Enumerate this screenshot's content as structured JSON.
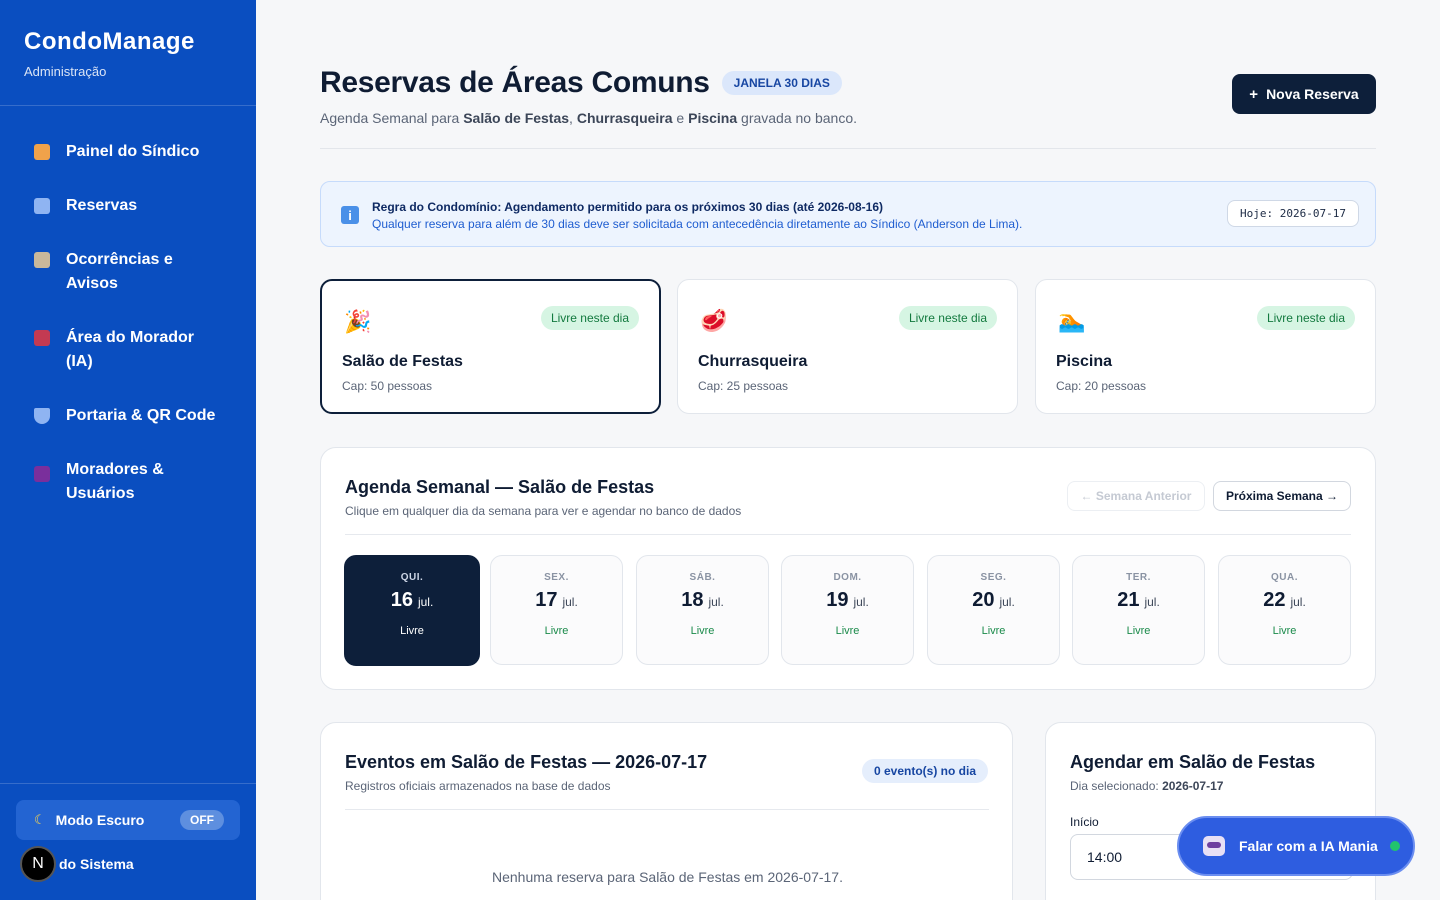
{
  "app": {
    "name": "CondoManage",
    "role": "Administração"
  },
  "sidebar": {
    "items": [
      {
        "label": "Painel do Síndico",
        "icon": "bar-chart-icon",
        "color": "#f0a24a"
      },
      {
        "label": "Reservas",
        "icon": "calendar-icon",
        "color": "#8fb4f2"
      },
      {
        "label": "Ocorrências e Avisos",
        "icon": "clipboard-icon",
        "color": "#c9b89b"
      },
      {
        "label": "Área do Morador (IA)",
        "icon": "building-icon",
        "color": "#c33a52"
      },
      {
        "label": "Portaria & QR Code",
        "icon": "shield-icon",
        "color": "#8fb4f2"
      },
      {
        "label": "Moradores & Usuários",
        "icon": "users-icon",
        "color": "#7a2f9c"
      }
    ],
    "dark_mode": {
      "label": "Modo Escuro",
      "state": "OFF"
    },
    "system": {
      "avatar": "N",
      "label": "do Sistema"
    }
  },
  "header": {
    "title": "Reservas de Áreas Comuns",
    "badge": "JANELA 30 DIAS",
    "subtitle": {
      "prefix": "Agenda Semanal para ",
      "area1": "Salão de Festas",
      "sep1": ", ",
      "area2": "Churrasqueira",
      "sep2": " e ",
      "area3": "Piscina",
      "suffix": " gravada no banco."
    },
    "new_button": {
      "icon": "+",
      "label": "Nova Reserva"
    }
  },
  "rule": {
    "icon": "i",
    "title": "Regra do Condomínio: Agendamento permitido para os próximos 30 dias (até 2026-08-16)",
    "text": "Qualquer reserva para além de 30 dias deve ser solicitada com antecedência diretamente ao Síndico (Anderson de Lima).",
    "today": "Hoje: 2026-07-17"
  },
  "areas": [
    {
      "name": "Salão de Festas",
      "capacity": "Cap: 50 pessoas",
      "status": "Livre neste dia",
      "emoji": "🎉",
      "selected": true
    },
    {
      "name": "Churrasqueira",
      "capacity": "Cap: 25 pessoas",
      "status": "Livre neste dia",
      "emoji": "🥩",
      "selected": false
    },
    {
      "name": "Piscina",
      "capacity": "Cap: 20 pessoas",
      "status": "Livre neste dia",
      "emoji": "🏊",
      "selected": false
    }
  ],
  "agenda": {
    "title": "Agenda Semanal — Salão de Festas",
    "subtitle": "Clique em qualquer dia da semana para ver e agendar no banco de dados",
    "prev_label": "← Semana Anterior",
    "next_label": "Próxima Semana →",
    "days": [
      {
        "weekday": "QUI.",
        "day": "16",
        "month": "jul.",
        "status": "Livre",
        "selected": true
      },
      {
        "weekday": "SEX.",
        "day": "17",
        "month": "jul.",
        "status": "Livre",
        "selected": false
      },
      {
        "weekday": "SÁB.",
        "day": "18",
        "month": "jul.",
        "status": "Livre",
        "selected": false
      },
      {
        "weekday": "DOM.",
        "day": "19",
        "month": "jul.",
        "status": "Livre",
        "selected": false
      },
      {
        "weekday": "SEG.",
        "day": "20",
        "month": "jul.",
        "status": "Livre",
        "selected": false
      },
      {
        "weekday": "TER.",
        "day": "21",
        "month": "jul.",
        "status": "Livre",
        "selected": false
      },
      {
        "weekday": "QUA.",
        "day": "22",
        "month": "jul.",
        "status": "Livre",
        "selected": false
      }
    ]
  },
  "events": {
    "title": "Eventos em Salão de Festas — 2026-07-17",
    "subtitle": "Registros oficiais armazenados na base de dados",
    "count": "0 evento(s) no dia",
    "empty": "Nenhuma reserva para Salão de Festas em 2026-07-17."
  },
  "schedule": {
    "title": "Agendar em Salão de Festas",
    "day_label": "Dia selecionado: ",
    "day_value": "2026-07-17",
    "start_label": "Início",
    "start_value": "14:00"
  },
  "ia": {
    "label": "Falar com a IA Mania"
  }
}
